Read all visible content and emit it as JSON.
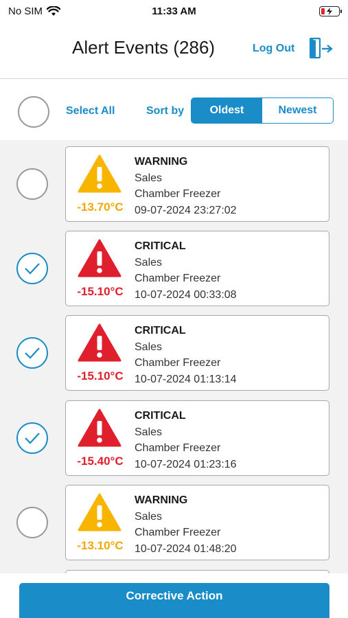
{
  "status_bar": {
    "carrier": "No SIM",
    "time": "11:33 AM"
  },
  "header": {
    "title": "Alert Events (286)",
    "logout_label": "Log Out"
  },
  "toolbar": {
    "select_all_label": "Select All",
    "sort_label": "Sort by",
    "sort_options": [
      "Oldest",
      "Newest"
    ],
    "sort_selected": "Oldest"
  },
  "colors": {
    "accent": "#1a8cc8",
    "warning": "#f0a800",
    "critical": "#e01f2d"
  },
  "alerts": [
    {
      "level": "WARNING",
      "department": "Sales",
      "location": "Chamber Freezer",
      "timestamp": "09-07-2024 23:27:02",
      "temp": "-13.70°C",
      "checked": false,
      "icon": "warning-triangle-icon"
    },
    {
      "level": "CRITICAL",
      "department": "Sales",
      "location": "Chamber Freezer",
      "timestamp": "10-07-2024 00:33:08",
      "temp": "-15.10°C",
      "checked": true,
      "icon": "critical-triangle-icon"
    },
    {
      "level": "CRITICAL",
      "department": "Sales",
      "location": "Chamber Freezer",
      "timestamp": "10-07-2024 01:13:14",
      "temp": "-15.10°C",
      "checked": true,
      "icon": "critical-triangle-icon"
    },
    {
      "level": "CRITICAL",
      "department": "Sales",
      "location": "Chamber Freezer",
      "timestamp": "10-07-2024 01:23:16",
      "temp": "-15.40°C",
      "checked": true,
      "icon": "critical-triangle-icon"
    },
    {
      "level": "WARNING",
      "department": "Sales",
      "location": "Chamber Freezer",
      "timestamp": "10-07-2024 01:48:20",
      "temp": "-13.10°C",
      "checked": false,
      "icon": "warning-triangle-icon"
    }
  ],
  "footer": {
    "corrective_action_label": "Corrective Action"
  }
}
